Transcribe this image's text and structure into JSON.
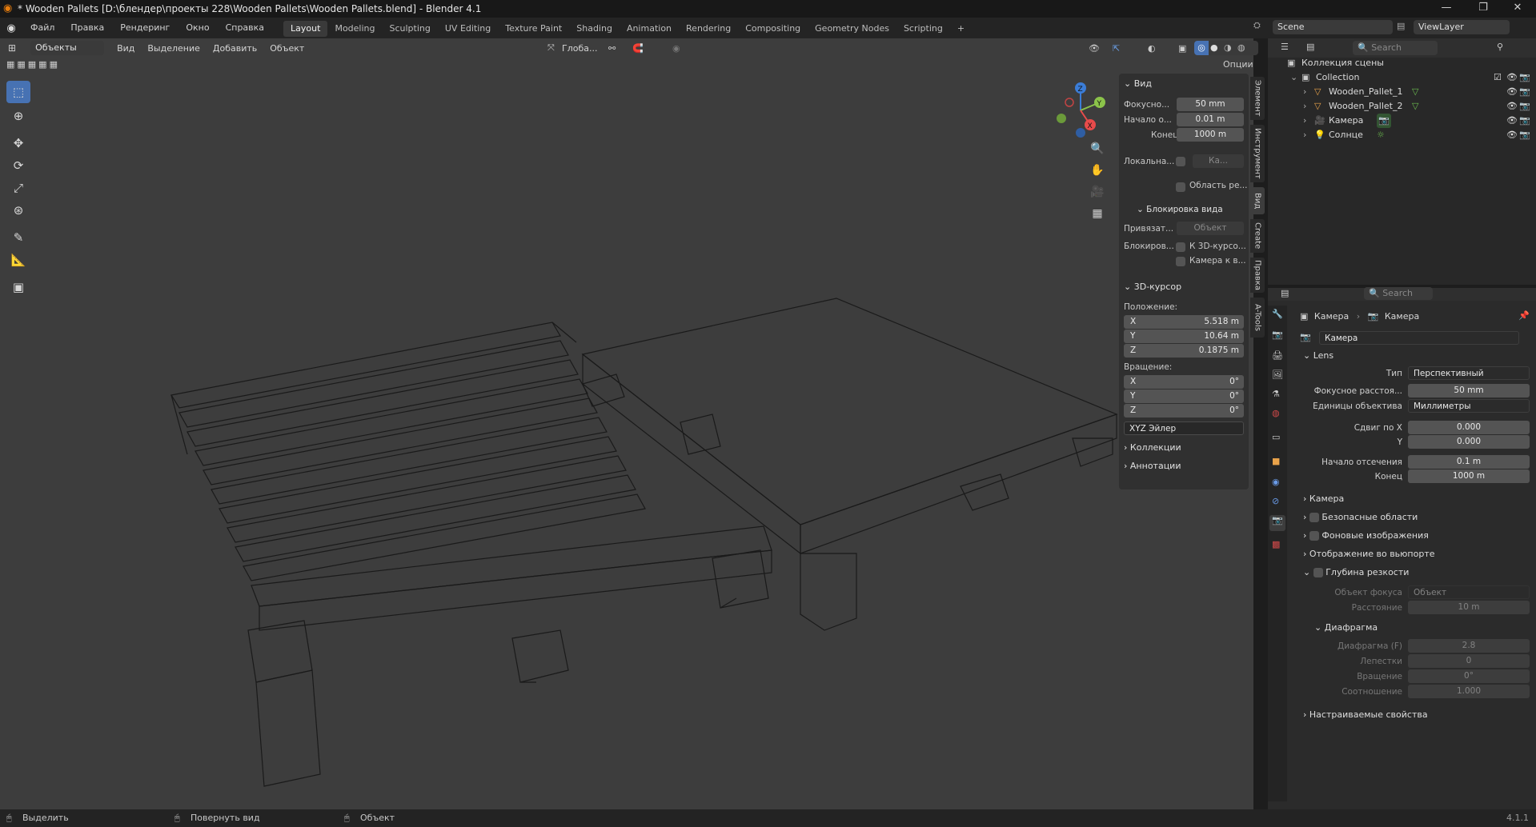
{
  "window": {
    "title": "* Wooden Pallets [D:\\блендер\\проекты 228\\Wooden Pallets\\Wooden Pallets.blend] - Blender 4.1",
    "minimize": "—",
    "maximize": "❐",
    "close": "✕"
  },
  "menu": [
    "Файл",
    "Правка",
    "Рендеринг",
    "Окно",
    "Справка"
  ],
  "workspaces": [
    "Layout",
    "Modeling",
    "Sculpting",
    "UV Editing",
    "Texture Paint",
    "Shading",
    "Animation",
    "Rendering",
    "Compositing",
    "Geometry Nodes",
    "Scripting",
    "+"
  ],
  "scene": "Scene",
  "view_layer": "ViewLayer",
  "viewport_header": {
    "mode": "Объекты",
    "items": [
      "Вид",
      "Выделение",
      "Добавить",
      "Объект"
    ],
    "transform": "Глоба...",
    "options": "Опции"
  },
  "npanel": {
    "view_title": "Вид",
    "focal_label": "Фокусно...",
    "focal_value": "50 mm",
    "clip_start_label": "Начало о...",
    "clip_start_value": "0.01 m",
    "clip_end_label": "Конец",
    "clip_end_value": "1000 m",
    "local_label": "Локальна...",
    "local_value": "Ка...",
    "render_region": "Область ре...",
    "lock_title": "Блокировка вида",
    "lock_to_label": "Привязат...",
    "lock_to_value": "Объект",
    "lock_label": "Блокиров...",
    "lock_cursor": "К 3D-курсо...",
    "lock_camera": "Камера к в...",
    "cursor_title": "3D-курсор",
    "location_label": "Положение:",
    "loc_x_label": "X",
    "loc_x": "5.518 m",
    "loc_y_label": "Y",
    "loc_y": "10.64 m",
    "loc_z_label": "Z",
    "loc_z": "0.1875 m",
    "rotation_label": "Вращение:",
    "rot_x_label": "X",
    "rot_x": "0°",
    "rot_y_label": "Y",
    "rot_y": "0°",
    "rot_z_label": "Z",
    "rot_z": "0°",
    "rot_mode": "XYZ Эйлер",
    "collections": "Коллекции",
    "annotations": "Аннотации"
  },
  "side_tabs": [
    "Элемент",
    "Инструмент",
    "Вид",
    "Create",
    "Правка",
    "A-Tools"
  ],
  "outliner": {
    "search": "Search",
    "scene_collection": "Коллекция сцены",
    "collection": "Collection",
    "objects": [
      "Wooden_Pallet_1",
      "Wooden_Pallet_2",
      "Камера",
      "Солнце"
    ]
  },
  "properties": {
    "search": "Search",
    "breadcrumb_obj": "Камера",
    "breadcrumb_data": "Камера",
    "datablock": "Камера",
    "lens_title": "Lens",
    "type_label": "Тип",
    "type_value": "Перспективный",
    "focal_label": "Фокусное расстоя...",
    "focal_value": "50 mm",
    "units_label": "Единицы объектива",
    "units_value": "Миллиметры",
    "shift_x_label": "Сдвиг по X",
    "shift_x": "0.000",
    "shift_y_label": "Y",
    "shift_y": "0.000",
    "clip_start_label": "Начало отсечения",
    "clip_start": "0.1 m",
    "clip_end_label": "Конец",
    "clip_end": "1000 m",
    "camera_panel": "Камера",
    "safe_areas": "Безопасные области",
    "bg_images": "Фоновые изображения",
    "viewport_display": "Отображение во вьюпорте",
    "dof": "Глубина резкости",
    "focus_obj_label": "Объект фокуса",
    "focus_obj_value": "Объект",
    "distance_label": "Расстояние",
    "distance_value": "10 m",
    "aperture_title": "Диафрагма",
    "fstop_label": "Диафрагма (F)",
    "fstop_value": "2.8",
    "blades_label": "Лепестки",
    "blades_value": "0",
    "rotation_label": "Вращение",
    "rotation_value": "0°",
    "ratio_label": "Соотношение",
    "ratio_value": "1.000",
    "custom_props": "Настраиваемые свойства"
  },
  "status": {
    "select": "Выделить",
    "rotate": "Повернуть вид",
    "object": "Объект",
    "version": "4.1.1"
  }
}
